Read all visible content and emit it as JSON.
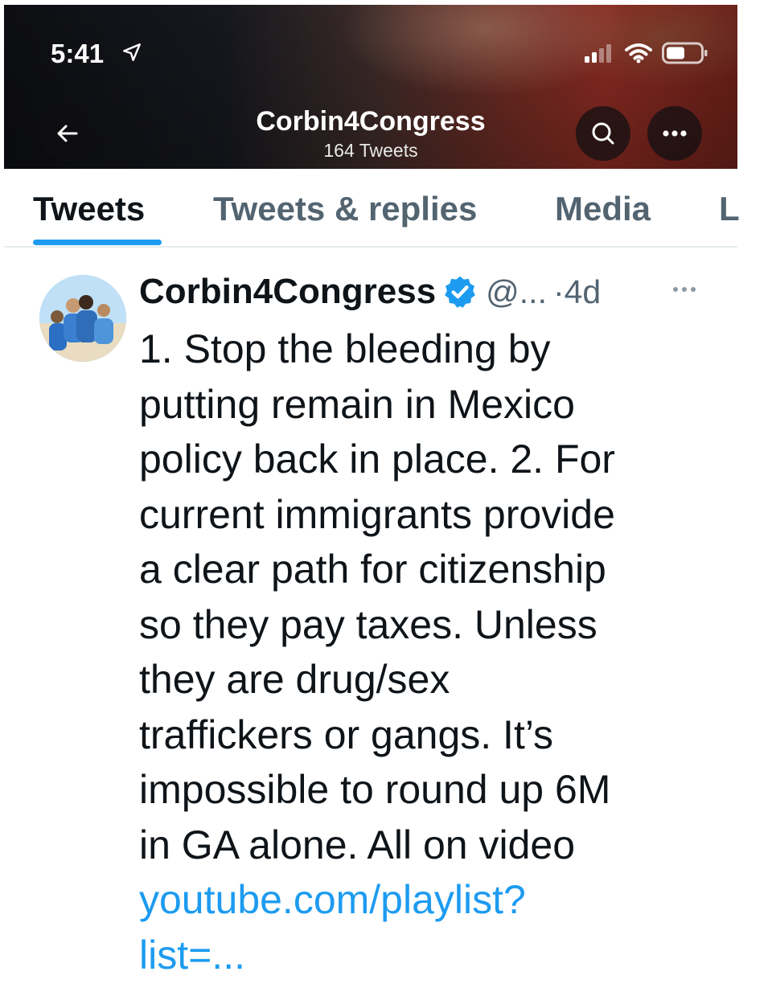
{
  "status_bar": {
    "time": "5:41",
    "icons": [
      "location-arrow-icon",
      "cellular-signal-icon",
      "wifi-icon",
      "battery-icon"
    ]
  },
  "header": {
    "name": "Corbin4Congress",
    "tweet_count": "164 Tweets",
    "icons": [
      "back-arrow-icon",
      "search-icon",
      "more-icon"
    ]
  },
  "tabs": [
    {
      "label": "Tweets",
      "active": true
    },
    {
      "label": "Tweets & replies",
      "active": false
    },
    {
      "label": "Media",
      "active": false
    },
    {
      "label": "L",
      "active": false
    }
  ],
  "tweet": {
    "author": "Corbin4Congress",
    "verified": true,
    "handle": "@...",
    "time": "·4d",
    "lines": [
      "1. Stop the bleeding by",
      "putting remain in Mexico",
      "policy back in place. 2. For",
      "current immigrants provide",
      "a clear path for citizenship",
      "so they pay taxes. Unless",
      "they are drug/sex",
      "traffickers or gangs. It’s",
      "impossible to round up 6M",
      "in GA alone. All on video"
    ],
    "link_lines": [
      "youtube.com/playlist?",
      "list=..."
    ]
  },
  "colors": {
    "accent": "#1d9bf0",
    "text": "#0f1419",
    "secondary": "#536471"
  }
}
